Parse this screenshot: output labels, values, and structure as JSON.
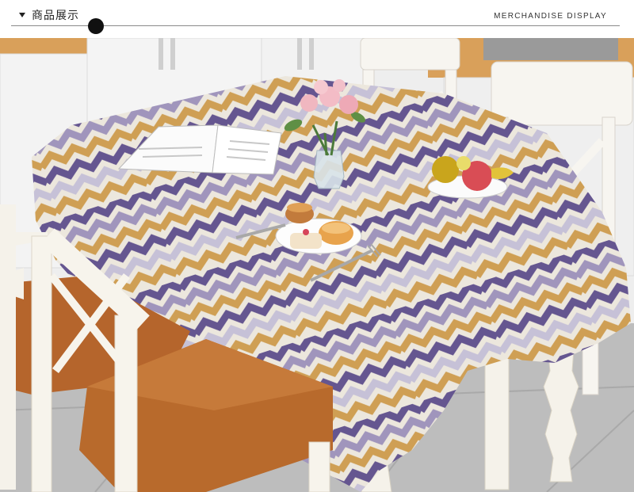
{
  "header": {
    "title": "商品展示",
    "subtitle": "MERCHANDISE DISPLAY"
  },
  "photo": {
    "subject": "tablecloth-on-dining-table",
    "colors": {
      "purple": "#6a5a96",
      "lavender": "#a79cc4",
      "gold": "#d8a658",
      "cream": "#f6f1e6",
      "wood": "#b86a2c",
      "cabinet": "#f0f0f0",
      "floor": "#b9b9b9"
    }
  }
}
